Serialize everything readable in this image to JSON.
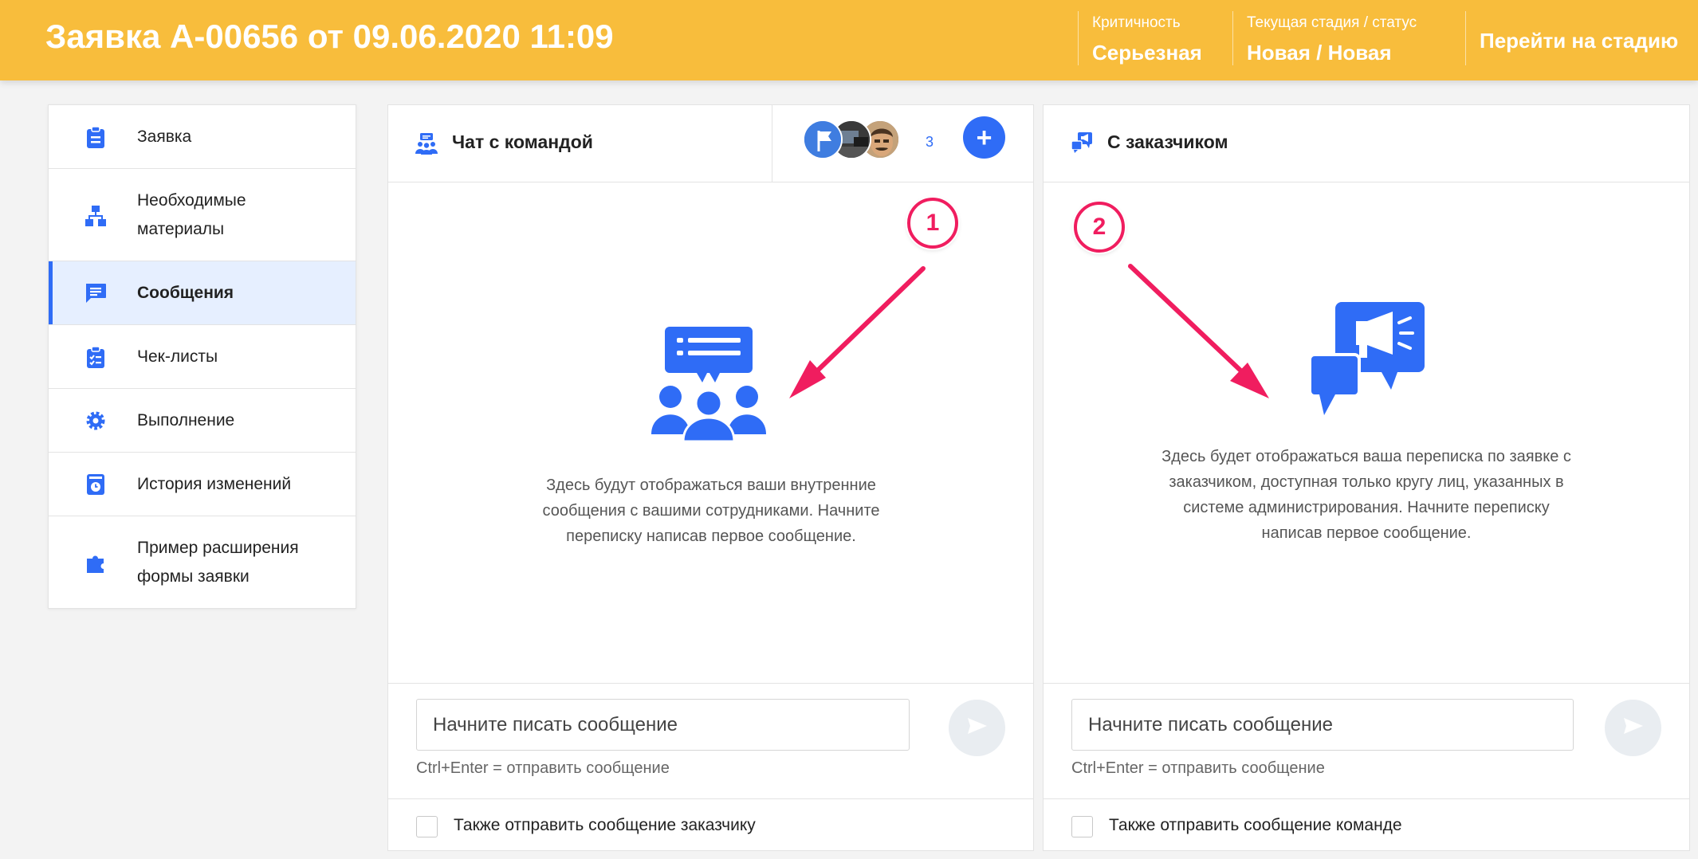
{
  "header": {
    "title": "Заявка А-00656 от 09.06.2020 11:09",
    "criticality_label": "Критичность",
    "criticality_value": "Серьезная",
    "stage_label": "Текущая стадия / статус",
    "stage_value": "Новая / Новая",
    "goto_label": "Перейти на стадию"
  },
  "sidebar": {
    "items": [
      {
        "label": "Заявка",
        "icon": "clipboard-icon"
      },
      {
        "label": "Необходимые материалы",
        "icon": "hierarchy-icon"
      },
      {
        "label": "Сообщения",
        "icon": "message-icon",
        "active": true
      },
      {
        "label": "Чек-листы",
        "icon": "checklist-icon"
      },
      {
        "label": "Выполнение",
        "icon": "gear-icon"
      },
      {
        "label": "История изменений",
        "icon": "history-icon"
      },
      {
        "label": "Пример расширения формы заявки",
        "icon": "puzzle-icon"
      }
    ]
  },
  "team_chat": {
    "title": "Чат с командой",
    "participants_count": "3",
    "empty_text": "Здесь будут отображаться ваши внутренние сообщения с вашими сотрудниками. Начните переписку написав первое сообщение.",
    "input_placeholder": "Начните писать сообщение",
    "hint": "Ctrl+Enter = отправить сообщение",
    "also_send_label": "Также отправить сообщение заказчику"
  },
  "customer_chat": {
    "title": "С заказчиком",
    "empty_text": "Здесь будет отображаться ваша переписка по заявке с заказчиком, доступная только кругу лиц, указанных в системе администрирования. Начните переписку написав первое сообщение.",
    "input_placeholder": "Начните писать сообщение",
    "hint": "Ctrl+Enter = отправить сообщение",
    "also_send_label": "Также отправить сообщение команде"
  },
  "annotations": {
    "badge_1": "1",
    "badge_2": "2"
  },
  "colors": {
    "header": "#f8bd3c",
    "accent": "#2f6cf6",
    "annotation": "#f01d5f"
  }
}
